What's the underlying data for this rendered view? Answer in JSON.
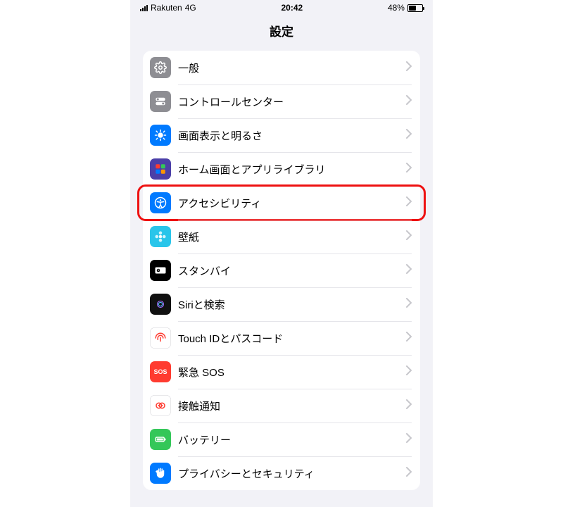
{
  "status": {
    "carrier": "Rakuten",
    "network": "4G",
    "time": "20:42",
    "battery_pct": "48%"
  },
  "header": {
    "title": "設定"
  },
  "rows": [
    {
      "id": "general",
      "label": "一般",
      "icon": "gear-icon",
      "bg": "#8e8e93",
      "fg": "#fff"
    },
    {
      "id": "control-center",
      "label": "コントロールセンター",
      "icon": "switches-icon",
      "bg": "#8e8e93",
      "fg": "#fff"
    },
    {
      "id": "display",
      "label": "画面表示と明るさ",
      "icon": "sun-icon",
      "bg": "#007aff",
      "fg": "#fff"
    },
    {
      "id": "home-screen",
      "label": "ホーム画面とアプリライブラリ",
      "icon": "grid-icon",
      "bg": "#4b3fa8",
      "fg": "#fff"
    },
    {
      "id": "accessibility",
      "label": "アクセシビリティ",
      "icon": "accessibility-icon",
      "bg": "#007aff",
      "fg": "#fff",
      "highlighted": true
    },
    {
      "id": "wallpaper",
      "label": "壁紙",
      "icon": "flower-icon",
      "bg": "#29c5ea",
      "fg": "#fff"
    },
    {
      "id": "standby",
      "label": "スタンバイ",
      "icon": "clock-dark-icon",
      "bg": "#000000",
      "fg": "#fff"
    },
    {
      "id": "siri",
      "label": "Siriと検索",
      "icon": "siri-icon",
      "bg": "#111111",
      "fg": "#fff"
    },
    {
      "id": "touchid",
      "label": "Touch IDとパスコード",
      "icon": "fingerprint-icon",
      "bg": "#ffffff",
      "fg": "#ff3b30",
      "border": true
    },
    {
      "id": "emergency-sos",
      "label": "緊急 SOS",
      "icon": "sos-icon",
      "bg": "#ff3b30",
      "fg": "#fff",
      "text": "SOS"
    },
    {
      "id": "exposure",
      "label": "接触通知",
      "icon": "exposure-icon",
      "bg": "#ffffff",
      "fg": "#ff3b30",
      "border": true
    },
    {
      "id": "battery",
      "label": "バッテリー",
      "icon": "battery-icon",
      "bg": "#34c759",
      "fg": "#fff"
    },
    {
      "id": "privacy",
      "label": "プライバシーとセキュリティ",
      "icon": "hand-icon",
      "bg": "#007aff",
      "fg": "#fff"
    }
  ]
}
